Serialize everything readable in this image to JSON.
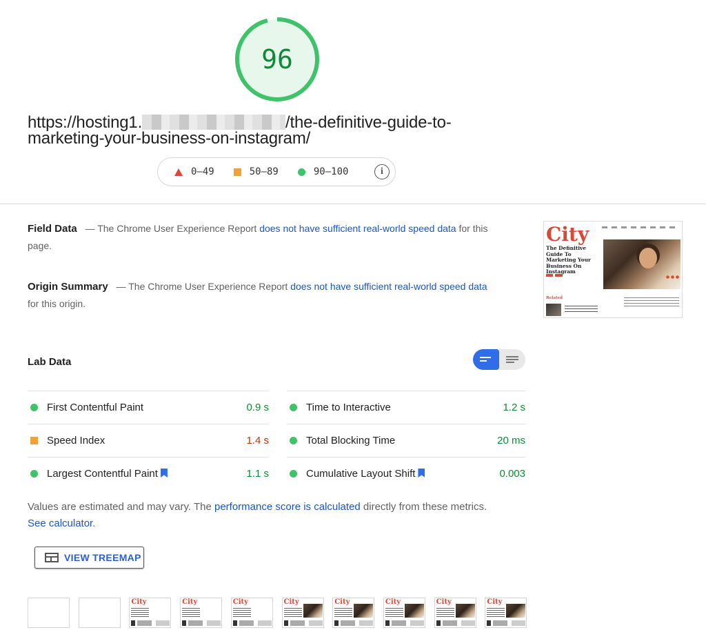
{
  "score": {
    "value": "96",
    "fraction": 0.96,
    "color": "#0c8a36"
  },
  "url": {
    "prefix": "https://hosting1.",
    "line1_suffix": "/the-definitive-guide-to-",
    "line2": "marketing-your-business-on-instagram/"
  },
  "legend": {
    "items": [
      {
        "icon": "triangle-icon",
        "label": "0–49",
        "color": "#e0453b"
      },
      {
        "icon": "square-icon",
        "label": "50–89",
        "color": "#f0a23a"
      },
      {
        "icon": "circle-icon",
        "label": "90–100",
        "color": "#3ec26a"
      }
    ],
    "info_icon_glyph": "i"
  },
  "field_data": {
    "heading": "Field Data",
    "text_before": "— The Chrome User Experience Report",
    "link": "does not have sufficient real-world speed data",
    "text_after": "for this page."
  },
  "origin_summary": {
    "heading": "Origin Summary",
    "text_before": "— The Chrome User Experience Report",
    "link": "does not have sufficient real-world speed data",
    "text_after": "for this origin."
  },
  "screenshot": {
    "logo": "City",
    "article_title": "The Definitive Guide To Marketing Your Business On Instagram",
    "related": "Related"
  },
  "lab_data": {
    "heading": "Lab Data",
    "metrics_left": [
      {
        "label": "First Contentful Paint",
        "value": "0.9 s",
        "status": "pass",
        "bookmark": false
      },
      {
        "label": "Speed Index",
        "value": "1.4 s",
        "status": "average",
        "bookmark": false
      },
      {
        "label": "Largest Contentful Paint",
        "value": "1.1 s",
        "status": "pass",
        "bookmark": true
      }
    ],
    "metrics_right": [
      {
        "label": "Time to Interactive",
        "value": "1.2 s",
        "status": "pass",
        "bookmark": false
      },
      {
        "label": "Total Blocking Time",
        "value": "20 ms",
        "status": "pass",
        "bookmark": false
      },
      {
        "label": "Cumulative Layout Shift",
        "value": "0.003",
        "status": "pass",
        "bookmark": true
      }
    ]
  },
  "notes": {
    "text1": "Values are estimated and may vary. The",
    "link1": "performance score is calculated",
    "text2": "directly from these metrics.",
    "link2": "See calculator",
    "text3": "."
  },
  "treemap_button": {
    "label": "VIEW TREEMAP"
  },
  "filmstrip": {
    "frames": [
      "blank",
      "blank",
      "partial",
      "partial",
      "partial",
      "full",
      "full",
      "full",
      "full",
      "full"
    ],
    "logo": "City"
  },
  "colors": {
    "pass": "#0c8a36",
    "average": "#c33300",
    "link": "#1a56c4",
    "accent": "#2f6ee8"
  }
}
